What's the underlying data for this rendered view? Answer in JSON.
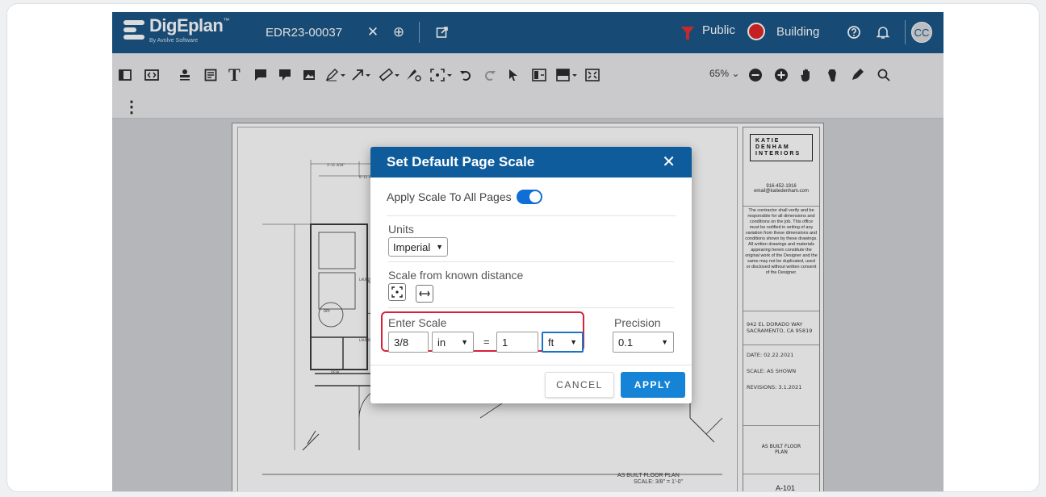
{
  "app": {
    "logo_name": "DigEplan",
    "logo_tm": "™",
    "logo_sub": "By Avolve Software",
    "document_id": "EDR23-00037",
    "status_public": "Public",
    "status_building": "Building",
    "user_initials": "CC",
    "accent": "#0f4f80"
  },
  "toolbar": {
    "zoom": "65%",
    "zoom_chevron": "⌄",
    "more": "⋮"
  },
  "drawing": {
    "company": "KATIE DENHAM INTERIORS",
    "phone": "916-452-1916",
    "email": "email@katiedenham.com",
    "disclaimer": "The contractor shall verify and be responsible for all dimensions and conditions on the job. This office must be notified in writing of any variation from these dimensions and conditions shown by these drawings. All written drawings and materials appearing herein constitute the original work of the Designer and the same may not be duplicated, used or disclosed without written consent of the Designer.",
    "address": "942 EL DORADO WAY SACRAMENTO, CA 95819",
    "date": "DATE: 02.22.2021",
    "scale": "SCALE: AS SHOWN",
    "revisions": "REVISIONS: 3.1.2021",
    "sheet_title": "AS BUILT FLOOR PLAN",
    "sheet_number": "A-101",
    "plan_caption": "AS BUILT FLOOR PLAN",
    "plan_scale": "SCALE: 3/8\" = 1'-0\""
  },
  "dialog": {
    "title": "Set Default Page Scale",
    "close": "✕",
    "apply_all_label": "Apply Scale To All Pages",
    "apply_all_on": true,
    "units_label": "Units",
    "units_value": "Imperial",
    "known_distance_label": "Scale from known distance",
    "enter_scale_label": "Enter Scale",
    "scale_from_value": "3/8",
    "scale_from_unit": "in",
    "equals": "=",
    "scale_to_value": "1",
    "scale_to_unit": "ft",
    "precision_label": "Precision",
    "precision_value": "0.1",
    "cancel_label": "CANCEL",
    "apply_label": "APPLY"
  }
}
